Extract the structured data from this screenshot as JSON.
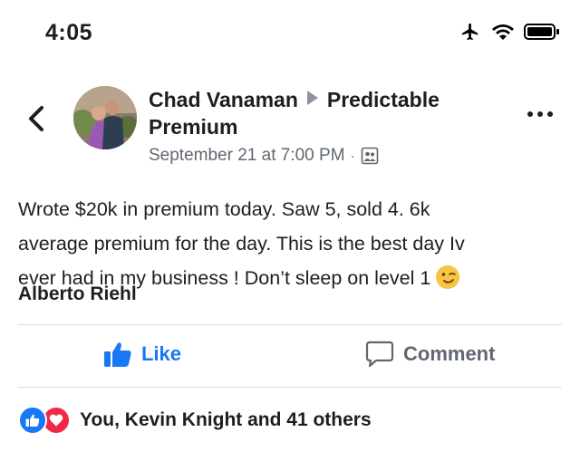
{
  "status_bar": {
    "time": "4:05"
  },
  "post": {
    "author": "Chad Vanaman",
    "group": "Predictable Premium",
    "timestamp": "September 21 at 7:00 PM",
    "separator": "·",
    "body_lines": [
      "Wrote $20k in premium today. Saw 5, sold 4. 6k",
      "average premium for the day. This is the best day Iv",
      "ever had in my business ! Don’t sleep on level 1"
    ],
    "tagged_user": "Alberto Riehl"
  },
  "actions": {
    "like_label": "Like",
    "comment_label": "Comment"
  },
  "reactions": {
    "summary": "You, Kevin Knight and 41 others"
  },
  "icons": [
    "airplane-icon",
    "wifi-icon",
    "battery-icon",
    "back-icon",
    "more-icon",
    "members-icon",
    "like-icon",
    "comment-icon",
    "wink-emoji",
    "like-reaction-icon",
    "love-reaction-icon"
  ],
  "colors": {
    "facebook_blue": "#1877f2",
    "love_red": "#f02849",
    "secondary_text": "#606770"
  }
}
